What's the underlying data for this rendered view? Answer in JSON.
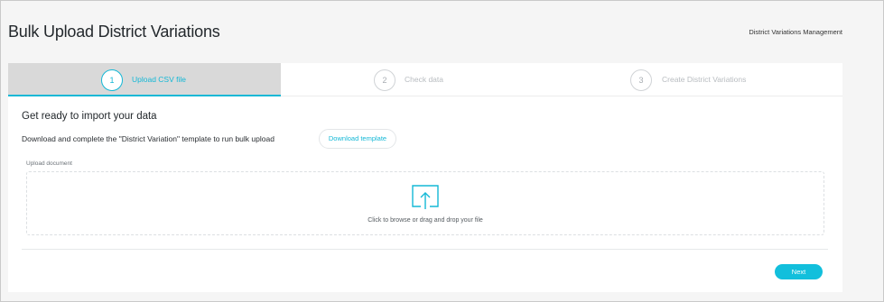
{
  "header": {
    "title": "Bulk Upload District Variations",
    "breadcrumb": "District Variations Management"
  },
  "stepper": {
    "steps": [
      {
        "number": "1",
        "label": "Upload CSV file",
        "state": "active"
      },
      {
        "number": "2",
        "label": "Check data",
        "state": "inactive"
      },
      {
        "number": "3",
        "label": "Create District Variations",
        "state": "inactive"
      }
    ]
  },
  "content": {
    "heading": "Get ready to import your data",
    "instruction": "Download and complete the \"District Variation\" template to run bulk upload",
    "download_label": "Download template",
    "upload_label": "Upload document",
    "upload_icon": "upload-icon",
    "dropzone_text": "Click to browse or drag and drop your file"
  },
  "footer": {
    "next_label": "Next"
  },
  "colors": {
    "accent": "#14b8d6",
    "active_step_bg": "#d9d9d9",
    "page_bg": "#f5f5f5"
  }
}
